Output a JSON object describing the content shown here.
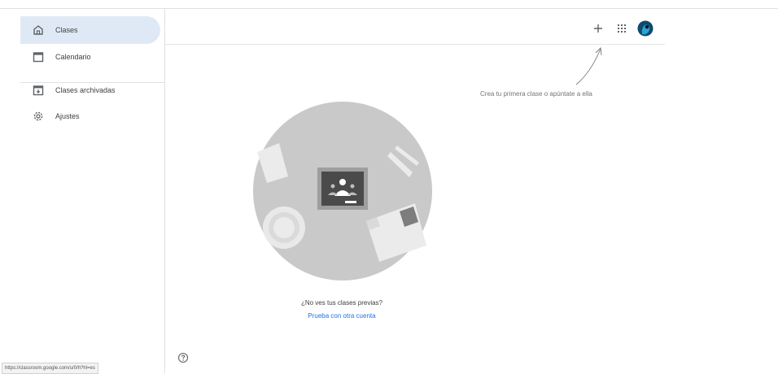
{
  "sidebar": {
    "items": [
      {
        "label": "Clases",
        "icon": "home-icon",
        "active": true
      },
      {
        "label": "Calendario",
        "icon": "calendar-icon"
      },
      {
        "label": "Clases archivadas",
        "icon": "archive-icon"
      },
      {
        "label": "Ajustes",
        "icon": "settings-icon"
      }
    ]
  },
  "header": {
    "add_icon": "plus-icon",
    "apps_icon": "apps-grid-icon",
    "avatar_icon": "avatar"
  },
  "main": {
    "hint": "Crea tu primera clase o apúntate a ella",
    "question": "¿No ves tus clases previas?",
    "link": "Prueba con otra cuenta"
  },
  "status_url": "https://classroom.google.com/u/0/h?hl=es",
  "colors": {
    "active_bg": "#dfe9f6",
    "link": "#1a73e8",
    "illustration_gray": "#c9c9c9"
  }
}
